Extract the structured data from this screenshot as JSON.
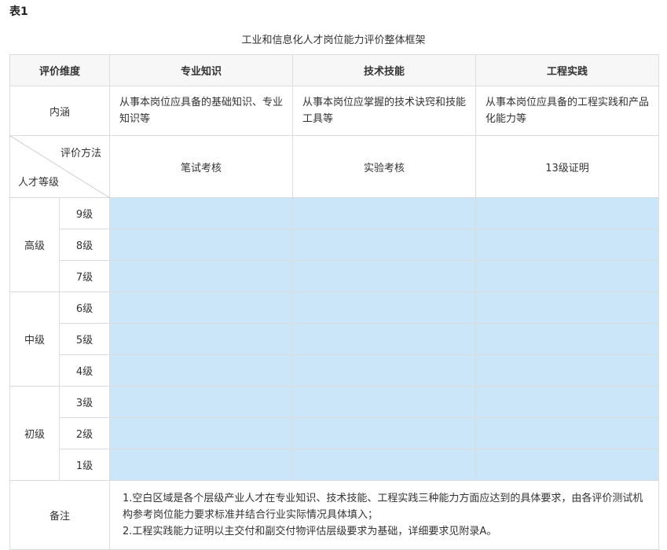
{
  "table_label": "表1",
  "caption": "工业和信息化人才岗位能力评价整体框架",
  "header": {
    "dimension": "评价维度",
    "col1": "专业知识",
    "col2": "技术技能",
    "col3": "工程实践"
  },
  "connotation": {
    "label": "内涵",
    "col1": "从事本岗位应具备的基础知识、专业知识等",
    "col2": "从事本岗位应掌握的技术诀窍和技能工具等",
    "col3": "从事本岗位应具备的工程实践和产品化能力等"
  },
  "method": {
    "diag_top": "评价方法",
    "diag_bottom": "人才等级",
    "col1": "笔试考核",
    "col2": "实验考核",
    "col3": "13级证明"
  },
  "groups": [
    {
      "name": "高级",
      "levels": [
        "9级",
        "8级",
        "7级"
      ]
    },
    {
      "name": "中级",
      "levels": [
        "6级",
        "5级",
        "4级"
      ]
    },
    {
      "name": "初级",
      "levels": [
        "3级",
        "2级",
        "1级"
      ]
    }
  ],
  "remarks": {
    "label": "备注",
    "line1": "1.空白区域是各个层级产业人才在专业知识、技术技能、工程实践三种能力方面应达到的具体要求，由各评价测试机构参考岗位能力要求标准并结合行业实际情况具体填入；",
    "line2": "2.工程实践能力证明以主交付和副交付物评估层级要求为基础，详细要求见附录A。"
  },
  "colors": {
    "highlight": "#cce6f9",
    "header_bg": "#f7f7f7",
    "border": "#dcdcdc"
  }
}
